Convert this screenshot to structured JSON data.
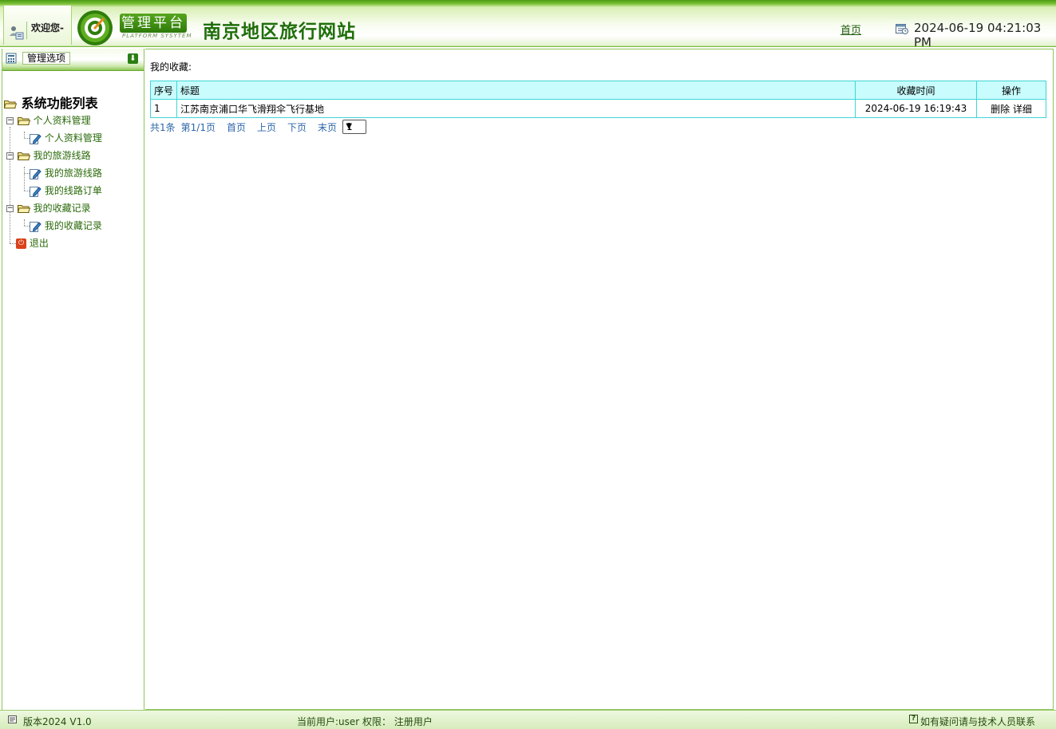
{
  "header": {
    "welcome": "欢迎您-",
    "platform_badge": "管理平台",
    "platform_sub": "PLATFORM SYSYTEM",
    "site_title": "南京地区旅行网站",
    "home_link": "首页",
    "datetime": "2024-06-19 04:21:03 PM"
  },
  "sidebar": {
    "header_label": "管理选项",
    "root_label": "系统功能列表",
    "groups": [
      {
        "label": "个人资料管理",
        "items": [
          {
            "label": "个人资料管理"
          }
        ]
      },
      {
        "label": "我的旅游线路",
        "items": [
          {
            "label": "我的旅游线路"
          },
          {
            "label": "我的线路订单"
          }
        ]
      },
      {
        "label": "我的收藏记录",
        "items": [
          {
            "label": "我的收藏记录"
          }
        ]
      }
    ],
    "exit_label": "退出"
  },
  "main": {
    "section_title": "我的收藏:",
    "table": {
      "columns": [
        "序号",
        "标题",
        "收藏时间",
        "操作"
      ],
      "rows": [
        {
          "no": "1",
          "title": "江苏南京浦口华飞滑翔伞飞行基地",
          "time": "2024-06-19 16:19:43",
          "delete": "删除",
          "detail": "详细"
        }
      ]
    },
    "pager": {
      "total": "共1条",
      "page": "第1/1页",
      "first": "首页",
      "prev": "上页",
      "next": "下页",
      "last": "末页",
      "select_value": "1"
    }
  },
  "footer": {
    "version": "版本2024 V1.0",
    "user_info": "当前用户:user 权限： 注册用户",
    "help": "如有疑问请与技术人员联系"
  },
  "colors": {
    "brand_green": "#2e7a0a",
    "table_header_bg": "#c8fcfd",
    "table_border": "#3ed5d6",
    "pager_link": "#2d66a8"
  }
}
